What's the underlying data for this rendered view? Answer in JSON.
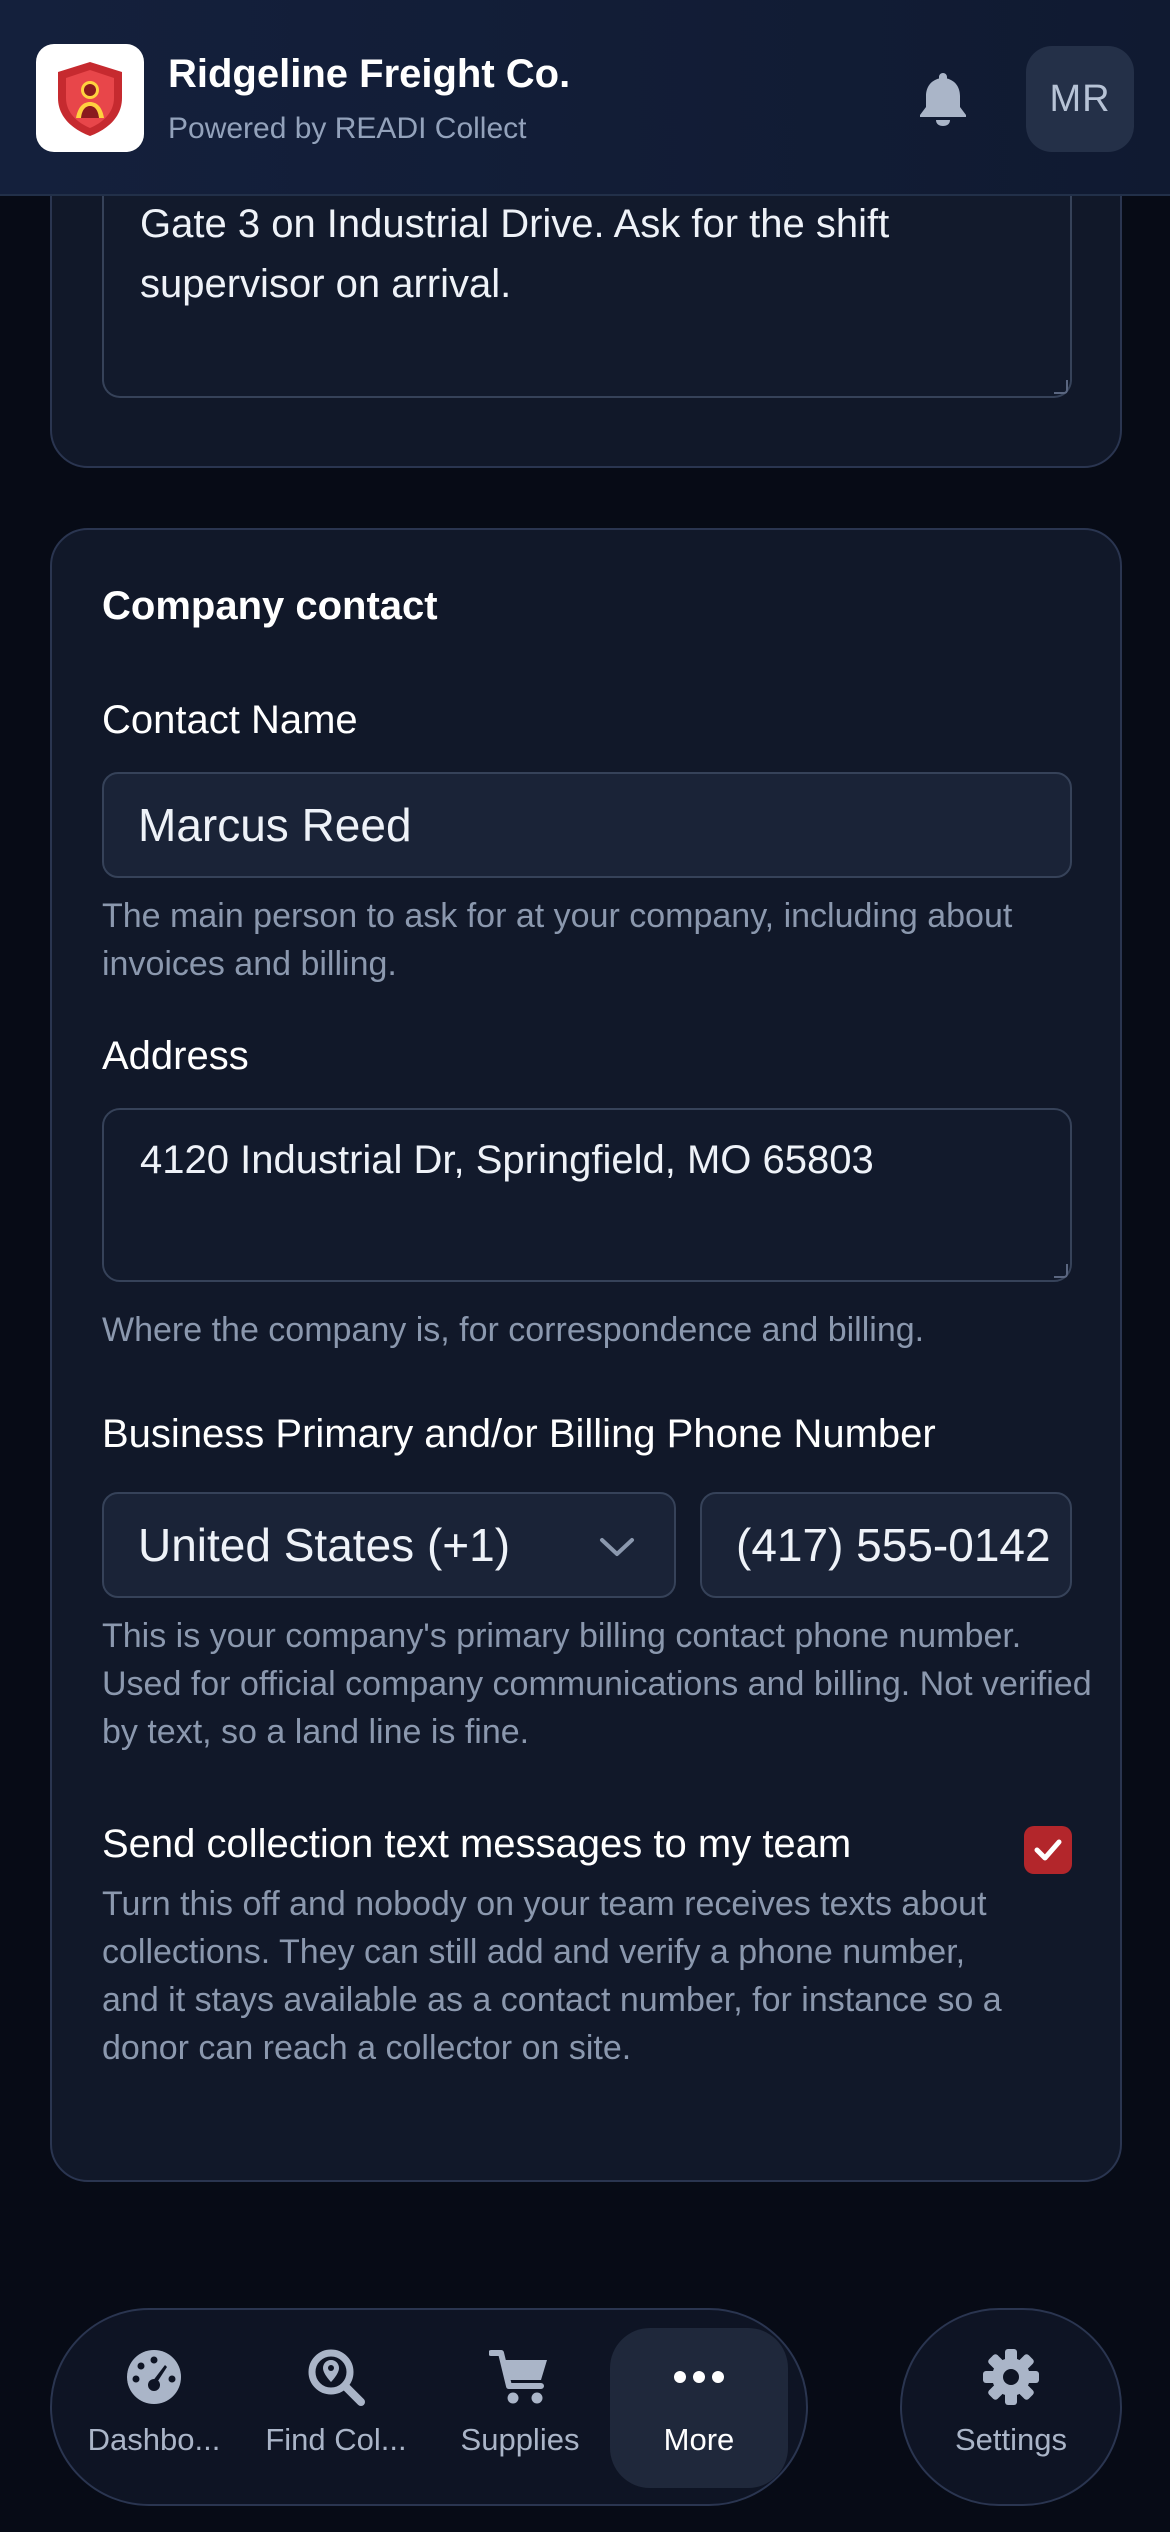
{
  "header": {
    "brand_name": "Ridgeline Freight Co.",
    "brand_sub": "Powered by READI Collect",
    "avatar_initials": "MR",
    "icons": {
      "logo": "shield-person-logo",
      "notifications": "bell-icon"
    }
  },
  "site_notes": {
    "value": "Gate 3 on Industrial Drive. Ask for the shift supervisor on arrival."
  },
  "company_contact": {
    "title": "Company contact",
    "contact_name": {
      "label": "Contact Name",
      "value": "Marcus Reed",
      "help": "The main person to ask for at your company, including about invoices and billing."
    },
    "address": {
      "label": "Address",
      "value": "4120 Industrial Dr, Springfield, MO 65803",
      "help": "Where the company is, for correspondence and billing."
    },
    "phone": {
      "label": "Business Primary and/or Billing Phone Number",
      "country": "United States (+1)",
      "number": "(417) 555-0142",
      "help": "This is your company's primary billing contact phone number. Used for official company communications and billing. Not verified by text, so a land line is fine."
    },
    "sms": {
      "label": "Send collection text messages to my team",
      "checked": true,
      "help": "Turn this off and nobody on your team receives texts about collections. They can still add and verify a phone number, and it stays available as a contact number, for instance so a donor can reach a collector on site."
    }
  },
  "bottom_nav": {
    "items": [
      {
        "label": "Dashbo...",
        "icon": "gauge-icon",
        "active": false
      },
      {
        "label": "Find Col...",
        "icon": "map-search-icon",
        "active": false
      },
      {
        "label": "Supplies",
        "icon": "cart-icon",
        "active": false
      },
      {
        "label": "More",
        "icon": "ellipsis-icon",
        "active": true
      }
    ],
    "settings": {
      "label": "Settings",
      "icon": "gear-icon"
    }
  },
  "colors": {
    "background": "#070b16",
    "card": "#111829",
    "accent_red": "#b3262b",
    "muted_text": "#8b98ae"
  }
}
